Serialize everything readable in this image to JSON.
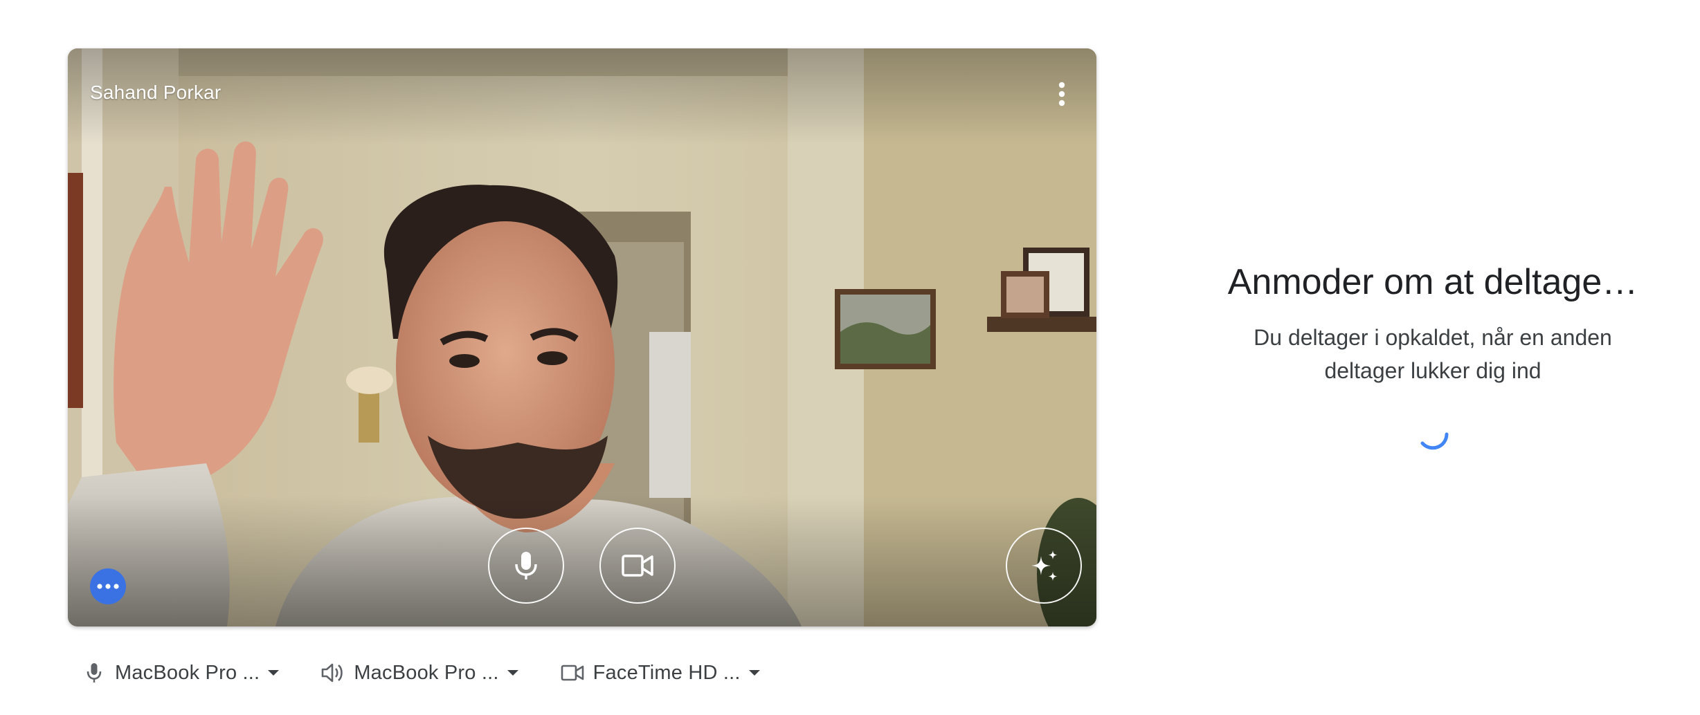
{
  "preview": {
    "participant_name": "Sahand Porkar"
  },
  "controls": {
    "microphone_icon": "mic-icon",
    "camera_icon": "videocam-icon",
    "effects_icon": "sparkle-icon",
    "more_options_icon": "more-vert-icon",
    "extra_options_icon": "more-horiz-icon"
  },
  "devices": {
    "microphone": "MacBook Pro ...",
    "speaker": "MacBook Pro ...",
    "camera": "FaceTime HD ..."
  },
  "join": {
    "title": "Anmoder om at deltage…",
    "subtitle": "Du deltager i opkaldet, når en anden deltager lukker dig ind"
  },
  "colors": {
    "accent": "#3b72e3",
    "spinner": "#4285f4",
    "text_primary": "#202124",
    "text_secondary": "#3c4043"
  }
}
